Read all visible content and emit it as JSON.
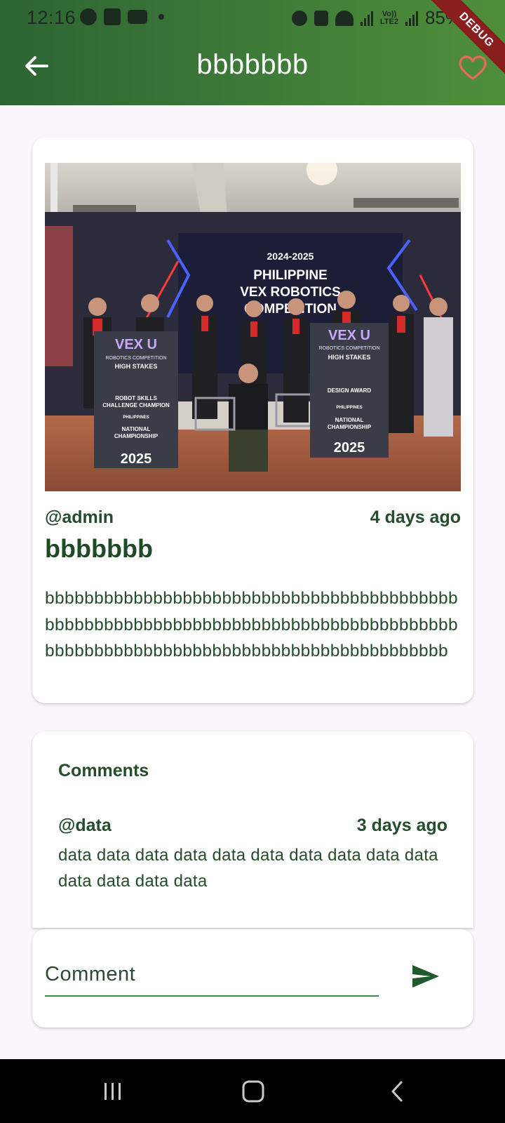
{
  "status_bar": {
    "time": "12:16",
    "battery": "85%",
    "volte_top": "Vo))",
    "volte_bottom": "LTE2"
  },
  "app_bar": {
    "title": "bbbbbbb",
    "back_icon": "arrow-back-icon",
    "favorite_icon": "heart-outline-icon",
    "debug_label": "DEBUG",
    "accent_color": "#e86a5a"
  },
  "post": {
    "photo_lines": [
      "2024-2025",
      "PHILIPPINE",
      "VEX ROBOTICS",
      "COMPETITION"
    ],
    "banner_left": {
      "brand": "VEX U",
      "subtitle": "ROBOTICS COMPETITION",
      "stakes": "HIGH STAKES",
      "award_line1": "ROBOT SKILLS",
      "award_line2": "CHALLENGE CHAMPION",
      "country": "PHILIPPINES",
      "event_line1": "NATIONAL",
      "event_line2": "CHAMPIONSHIP",
      "year": "2025"
    },
    "banner_right": {
      "brand": "VEX U",
      "subtitle": "ROBOTICS COMPETITION",
      "stakes": "HIGH STAKES",
      "award_line1": "DESIGN AWARD",
      "country": "PHILIPPINES",
      "event_line1": "NATIONAL",
      "event_line2": "CHAMPIONSHIP",
      "year": "2025"
    },
    "author": "@admin",
    "time_ago": "4 days ago",
    "title": "bbbbbbb",
    "body": "bbbbbbbbbbbbbbbbbbbbbbbbbbbbbbbbbbbbbbbbbbbbbbbbbbbbbbbbbbbbbbbbbbbbbbbbbbbbbbbbbbbbbbbbbbbbbbbbbbbbbbbbbbbbbbbbbbbbbbbbbbbbb"
  },
  "comments": {
    "heading": "Comments",
    "items": [
      {
        "author": "@data",
        "time_ago": "3 days ago",
        "text": "data data data data data data data data data data data data data data"
      }
    ]
  },
  "comment_input": {
    "placeholder": "Comment",
    "value": "",
    "send_icon": "send-icon"
  },
  "nav_bar": {
    "recents_icon": "recents-icon",
    "home_icon": "home-icon",
    "back_icon": "back-chevron-icon"
  }
}
